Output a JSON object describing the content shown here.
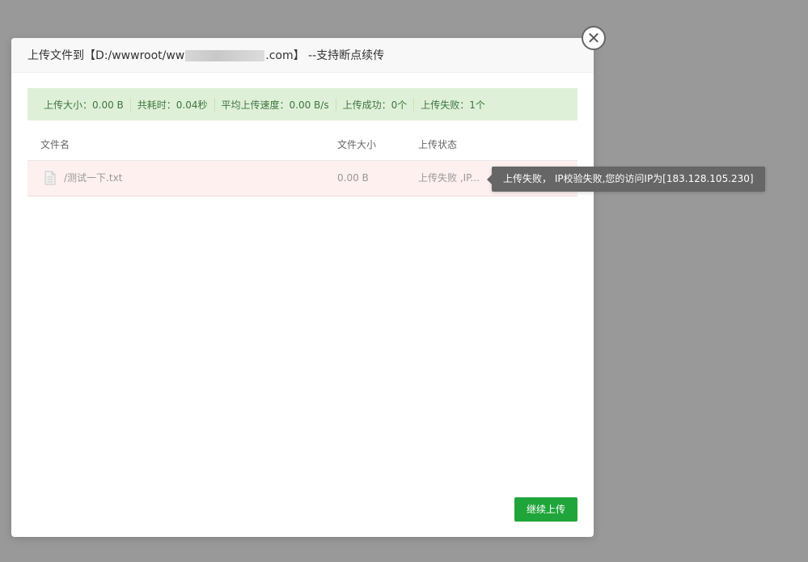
{
  "dialog": {
    "title_prefix": "上传文件到【D:/wwwroot/ww",
    "title_suffix": ".com】 --支持断点续传"
  },
  "stats": {
    "upload_size": "上传大小：0.00 B",
    "time_used": "共耗时：0.04秒",
    "avg_speed": "平均上传速度：0.00 B/s",
    "success": "上传成功：0个",
    "failed": "上传失败：1个"
  },
  "table": {
    "headers": [
      "文件名",
      "文件大小",
      "上传状态"
    ],
    "rows": [
      {
        "name": "/测试一下.txt",
        "size": "0.00 B",
        "status": "上传失败 ,IP..."
      }
    ]
  },
  "tooltip": {
    "text": "上传失败， IP校验失败,您的访问IP为[183.128.105.230]"
  },
  "buttons": {
    "continue": "继续上传"
  },
  "colors": {
    "accent": "#20a53a",
    "stats_bg": "#dff0d8",
    "error_row_bg": "#fdf0ef"
  }
}
